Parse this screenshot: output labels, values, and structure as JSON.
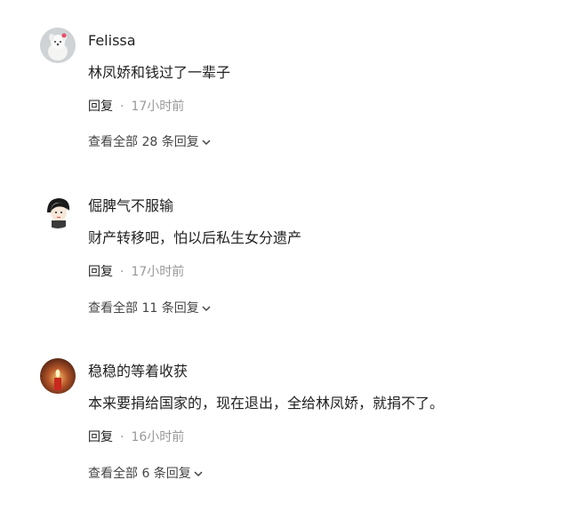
{
  "comments": [
    {
      "username": "Felissa",
      "content": "林凤娇和钱过了一辈子",
      "reply_label": "回复",
      "separator": "·",
      "time": "17小时前",
      "view_replies": "查看全部 28 条回复",
      "avatar_icon": "white-dog-avatar"
    },
    {
      "username": "倔脾气不服输",
      "content": "财产转移吧，怕以后私生女分遗产",
      "reply_label": "回复",
      "separator": "·",
      "time": "17小时前",
      "view_replies": "查看全部 11 条回复",
      "avatar_icon": "cartoon-person-avatar"
    },
    {
      "username": "稳稳的等着收获",
      "content": "本来要捐给国家的，现在退出，全给林凤娇，就捐不了。",
      "reply_label": "回复",
      "separator": "·",
      "time": "16小时前",
      "view_replies": "查看全部 6 条回复",
      "avatar_icon": "candle-avatar"
    }
  ],
  "icons": {
    "expand": "chevron-down-icon"
  },
  "colors": {
    "text_primary": "#222222",
    "text_secondary": "#999999",
    "link_text": "#444444"
  }
}
